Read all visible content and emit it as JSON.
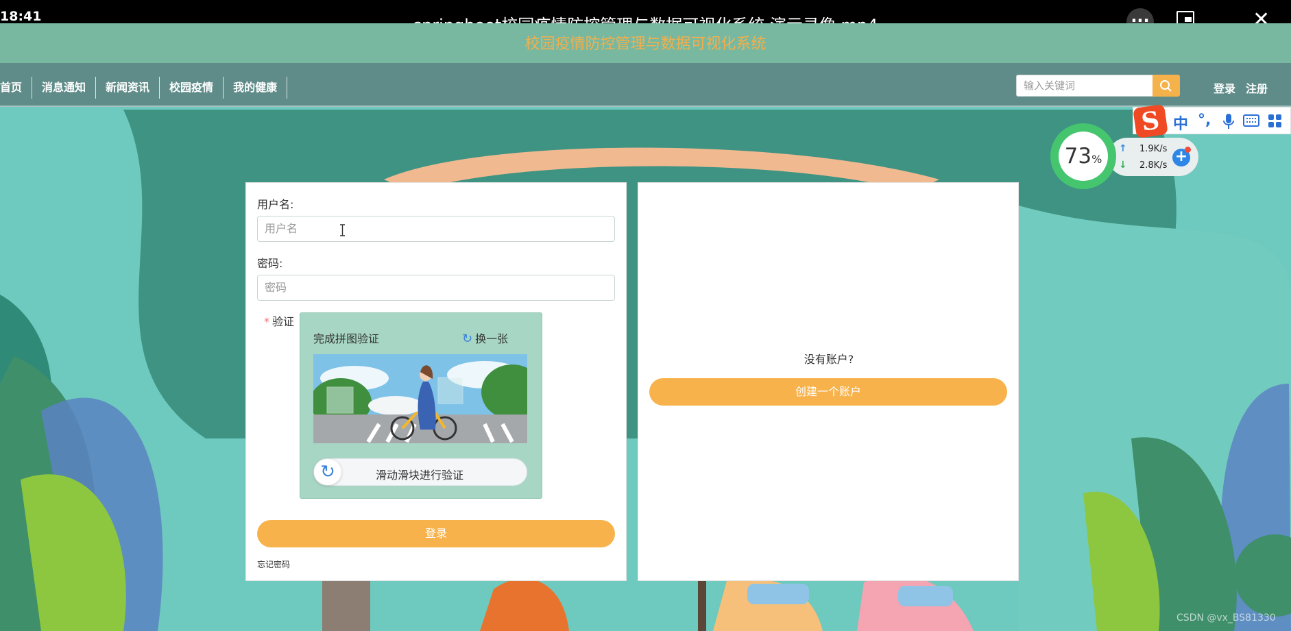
{
  "player": {
    "clock": "18:41",
    "title": "springboot校园疫情防控管理与数据可视化系统 演示录像.mp4",
    "more_label": "···",
    "close_label": "✕"
  },
  "site": {
    "title": "校园疫情防控管理与数据可视化系统",
    "nav": [
      "首页",
      "消息通知",
      "新闻资讯",
      "校园疫情",
      "我的健康"
    ],
    "search_placeholder": "输入关键词",
    "login_link": "登录",
    "register_link": "注册"
  },
  "ime": {
    "logo": "S",
    "keys": [
      "中",
      "°,",
      "🎤",
      "⌨",
      "▦"
    ]
  },
  "net_speed": {
    "percent": "73",
    "percent_unit": "%",
    "upload": "1.9K/s",
    "download": "2.8K/s",
    "up_arrow": "↑",
    "down_arrow": "↓"
  },
  "login_form": {
    "username_label": "用户名:",
    "username_placeholder": "用户名",
    "password_label": "密码:",
    "password_placeholder": "密码",
    "verify_star": "*",
    "verify_label": "验证",
    "captcha_title": "完成拼图验证",
    "captcha_refresh": "换一张",
    "slider_text": "滑动滑块进行验证",
    "submit": "登录",
    "forgot": "忘记密码"
  },
  "register_card": {
    "question": "没有账户?",
    "button": "创建一个账户"
  },
  "watermark": "CSDN @vx_BS81330",
  "colors": {
    "accent_orange": "#f7b24b",
    "nav_bg": "#5f8c89",
    "title_bar_bg": "#78b8a0",
    "captcha_bg": "#a7d6c4"
  }
}
